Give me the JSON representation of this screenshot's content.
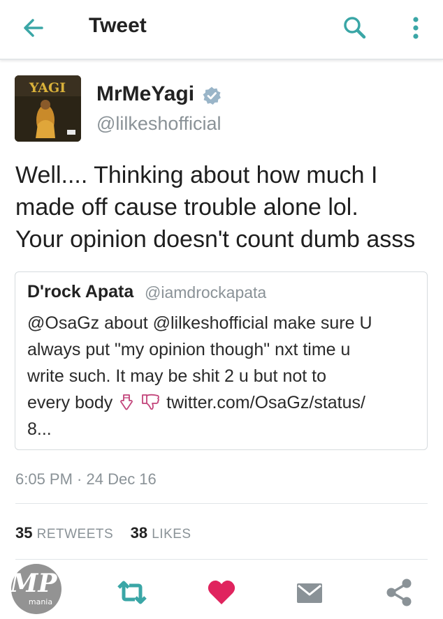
{
  "header": {
    "title": "Tweet",
    "back_icon": "arrow-left-icon",
    "search_icon": "search-icon",
    "overflow_icon": "more-vertical-icon",
    "accent_color": "#3aa6a6"
  },
  "author": {
    "display_name": "MrMeYagi",
    "handle": "@lilkeshofficial",
    "avatar_text": "YAGI",
    "verified": true,
    "verified_color": "#9ab5c8"
  },
  "tweet": {
    "lines": [
      "Well.... Thinking about how much I",
      "made off cause trouble alone lol.",
      "Your opinion doesn't count dumb asss"
    ]
  },
  "quote": {
    "name": "D'rock Apata",
    "handle": "@iamdrockapata",
    "lines": [
      "@OsaGz  about @lilkeshofficial make sure U",
      "always put \"my opinion though\" nxt time u",
      "write such. It may be shit 2 u but not to"
    ],
    "line4_prefix": "every body",
    "line4_suffix": "twitter.com/OsaGz/status/",
    "line5": "8...",
    "emojis": [
      "pointing-down-icon",
      "thumbs-down-icon"
    ]
  },
  "meta": {
    "timestamp": "6:05 PM · 24 Dec 16"
  },
  "stats": {
    "retweets_count": "35",
    "retweets_label": "RETWEETS",
    "likes_count": "38",
    "likes_label": "LIKES"
  },
  "actions": {
    "icons": [
      "retweet-icon",
      "heart-icon",
      "message-icon",
      "share-icon"
    ],
    "retweet_color": "#3aa6a6",
    "like_color": "#e0245e"
  },
  "watermark": {
    "text": "MP",
    "subtext": "mania"
  }
}
